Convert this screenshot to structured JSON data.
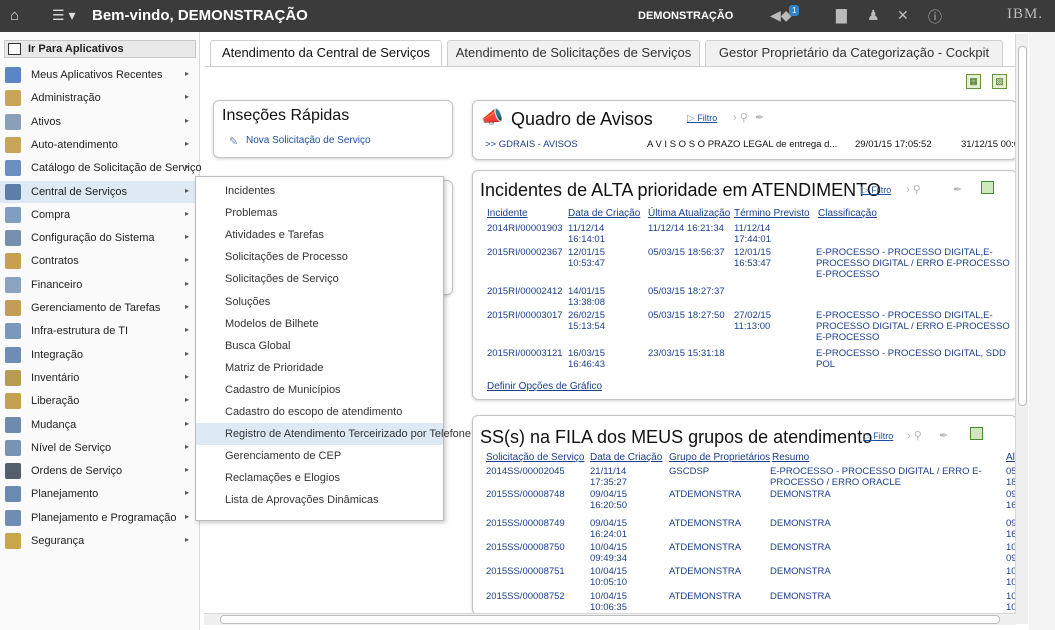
{
  "header": {
    "title": "Bem-vindo, DEMONSTRAÇÃO",
    "user": "DEMONSTRAÇÃO",
    "notification_count": "1",
    "brand": "IBM."
  },
  "leftmenu": {
    "header": "Ir Para Aplicativos",
    "items": [
      {
        "label": "Meus Aplicativos Recentes",
        "color": "#5b86c5"
      },
      {
        "label": "Administração",
        "color": "#c9a55a"
      },
      {
        "label": "Ativos",
        "color": "#8aa0b8"
      },
      {
        "label": "Auto-atendimento",
        "color": "#c9a55a"
      },
      {
        "label": "Catálogo de Solicitação de Serviço",
        "color": "#6d8fbf"
      },
      {
        "label": "Central de Serviços",
        "color": "#5d7ea8"
      },
      {
        "label": "Compra",
        "color": "#7f9ec2"
      },
      {
        "label": "Configuração do Sistema",
        "color": "#7890b0"
      },
      {
        "label": "Contratos",
        "color": "#c7a050"
      },
      {
        "label": "Financeiro",
        "color": "#8aa4c0"
      },
      {
        "label": "Gerenciamento de Tarefas",
        "color": "#c39d55"
      },
      {
        "label": "Infra-estrutura de TI",
        "color": "#7b97bb"
      },
      {
        "label": "Integração",
        "color": "#6f8cb5"
      },
      {
        "label": "Inventário",
        "color": "#b99a55"
      },
      {
        "label": "Liberação",
        "color": "#c5a050"
      },
      {
        "label": "Mudança",
        "color": "#6e8aaf"
      },
      {
        "label": "Nível de Serviço",
        "color": "#7893b6"
      },
      {
        "label": "Ordens de Serviço",
        "color": "#555f6b"
      },
      {
        "label": "Planejamento",
        "color": "#6b8ab2"
      },
      {
        "label": "Planejamento e Programação",
        "color": "#6f8db2"
      },
      {
        "label": "Segurança",
        "color": "#c9a64a"
      }
    ]
  },
  "submenu": {
    "items": [
      "Incidentes",
      "Problemas",
      "Atividades e Tarefas",
      "Solicitações de Processo",
      "Solicitações de Serviço",
      "Soluções",
      "Modelos de Bilhete",
      "Busca Global",
      "Matriz de Prioridade",
      "Cadastro de Municípios",
      "Cadastro do escopo de atendimento",
      "Registro de Atendimento Terceirizado por Telefone",
      "Gerenciamento de CEP",
      "Reclamações e Elogios",
      "Lista de Aprovações Dinâmicas"
    ]
  },
  "tabs": [
    "Atendimento da Central de Serviços",
    "Atendimento de Solicitações de Serviços",
    "Gestor Proprietário da Categorização - Cockpit"
  ],
  "quick": {
    "title": "Inseções Rápidas",
    "link": "Nova Solicitação de Serviço"
  },
  "bulletin": {
    "title": "Quadro de Avisos",
    "filter": "Filtro",
    "from": ">> GDRAIS - AVISOS",
    "subject": "A V I S O S O PRAZO LEGAL de entrega d...",
    "posted": "29/01/15 17:05:52",
    "expires": "31/12/15 00:00"
  },
  "incidents": {
    "title": "Incidentes de ALTA prioridade em ATENDIMENTO",
    "filter": "Filtro",
    "columns": [
      "Incidente",
      "Data de Criação",
      "Última Atualização",
      "Término Previsto",
      "Classificação"
    ],
    "rows": [
      {
        "id": "2014RI/00001903",
        "created": "11/12/14 16:14:01",
        "updated": "11/12/14 16:21:34",
        "due": "11/12/14 17:44:01",
        "class": ""
      },
      {
        "id": "2015RI/00002367",
        "created": "12/01/15 10:53:47",
        "updated": "05/03/15 18:56:37",
        "due": "12/01/15 16:53:47",
        "class": "E-PROCESSO - PROCESSO DIGITAL,E-PROCESSO DIGITAL / ERRO E-PROCESSO E-PROCESSO"
      },
      {
        "id": "2015RI/00002412",
        "created": "14/01/15 13:38:08",
        "updated": "05/03/15 18:27:37",
        "due": "",
        "class": ""
      },
      {
        "id": "2015RI/00003017",
        "created": "26/02/15 15:13:54",
        "updated": "05/03/15 18:27:50",
        "due": "27/02/15 11:13:00",
        "class": "E-PROCESSO - PROCESSO DIGITAL,E-PROCESSO DIGITAL / ERRO E-PROCESSO E-PROCESSO"
      },
      {
        "id": "2015RI/00003121",
        "created": "16/03/15 16:46:43",
        "updated": "23/03/15 15:31:18",
        "due": "",
        "class": "E-PROCESSO - PROCESSO DIGITAL, SDD POL"
      }
    ],
    "chart_link": "Definir Opções de Gráfico"
  },
  "queue": {
    "title": "SS(s) na FILA dos MEUS grupos de atendimento",
    "filter": "Filtro",
    "columns": [
      "Solicitação de Serviço",
      "Data de Criação",
      "Grupo de Proprietários",
      "Resumo",
      "Al"
    ],
    "rows": [
      {
        "id": "2014SS/00002045",
        "created": "21/11/14 17:35:27",
        "group": "GSCDSP",
        "summary": "E-PROCESSO - PROCESSO DIGITAL / ERRO E-PROCESSO / ERRO ORACLE",
        "extra": "05 18:"
      },
      {
        "id": "2015SS/00008748",
        "created": "09/04/15 16:20:50",
        "group": "ATDEMONSTRA",
        "summary": "DEMONSTRA",
        "extra": "09 16:"
      },
      {
        "id": "2015SS/00008749",
        "created": "09/04/15 16:24:01",
        "group": "ATDEMONSTRA",
        "summary": "DEMONSTRA",
        "extra": "09 16:"
      },
      {
        "id": "2015SS/00008750",
        "created": "10/04/15 09:49:34",
        "group": "ATDEMONSTRA",
        "summary": "DEMONSTRA",
        "extra": "10 09:"
      },
      {
        "id": "2015SS/00008751",
        "created": "10/04/15 10:05:10",
        "group": "ATDEMONSTRA",
        "summary": "DEMONSTRA",
        "extra": "10 10:"
      },
      {
        "id": "2015SS/00008752",
        "created": "10/04/15 10:06:35",
        "group": "ATDEMONSTRA",
        "summary": "DEMONSTRA",
        "extra": "10 10:"
      }
    ]
  }
}
